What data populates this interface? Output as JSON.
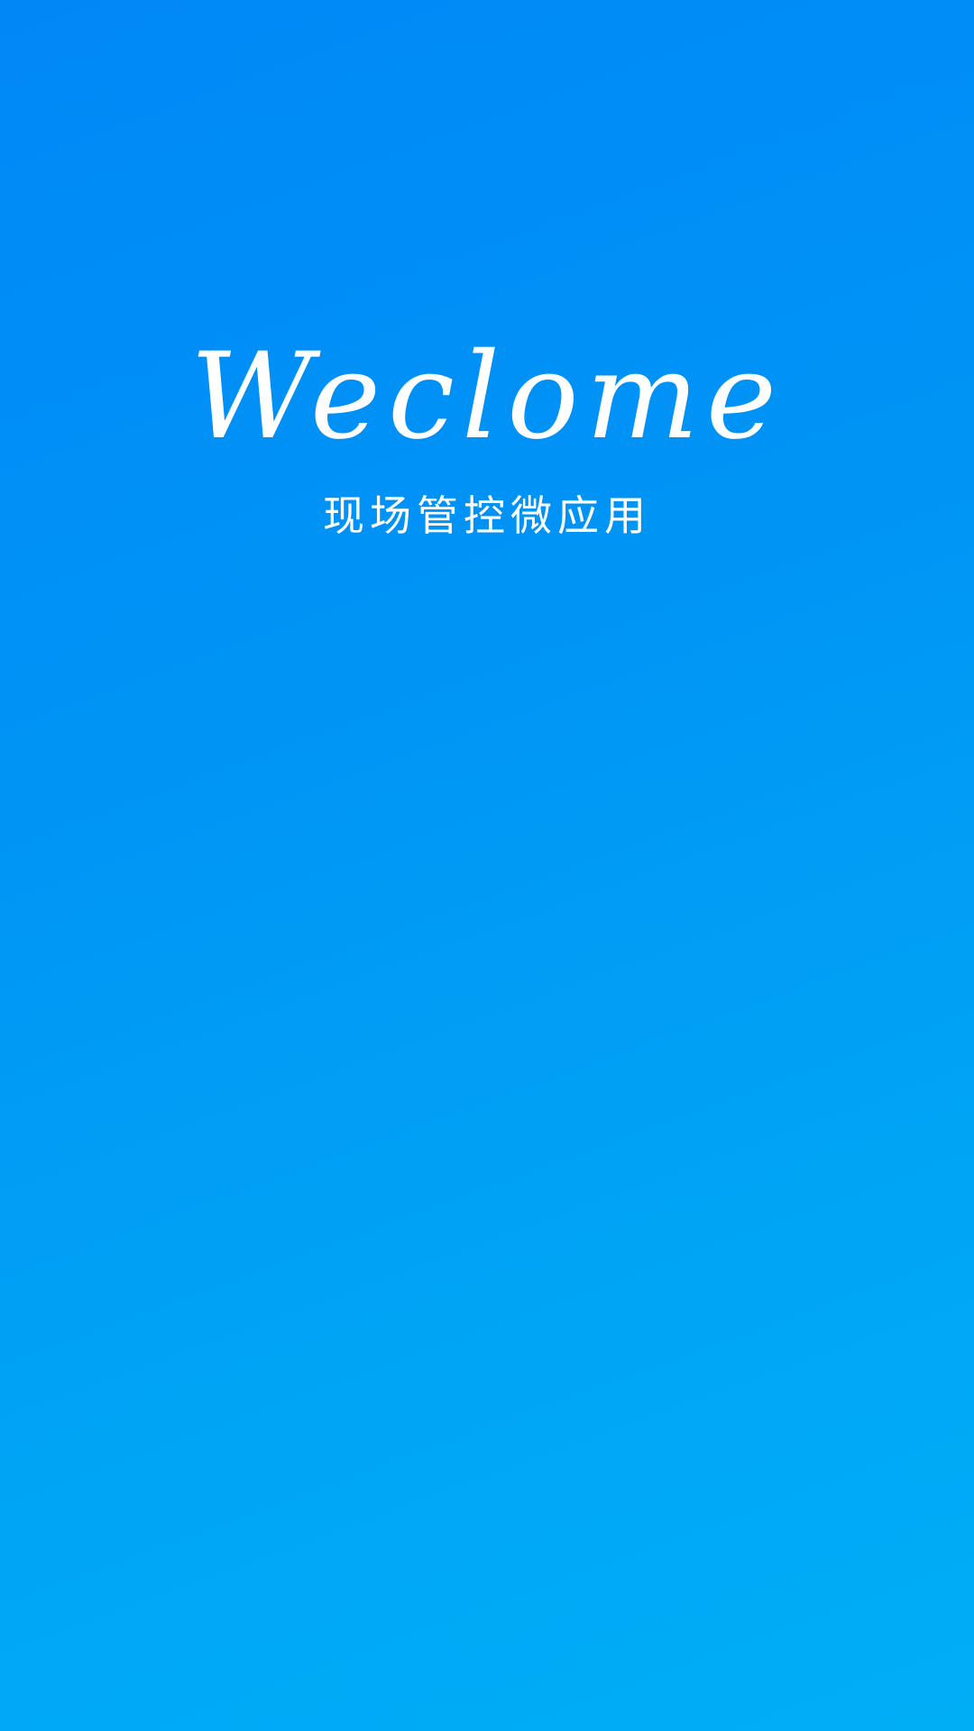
{
  "splash": {
    "title": "Weclome",
    "subtitle": "现场管控微应用"
  },
  "colors": {
    "gradient_start": "#0088f7",
    "gradient_end": "#00aef6",
    "text": "#ffffff"
  }
}
